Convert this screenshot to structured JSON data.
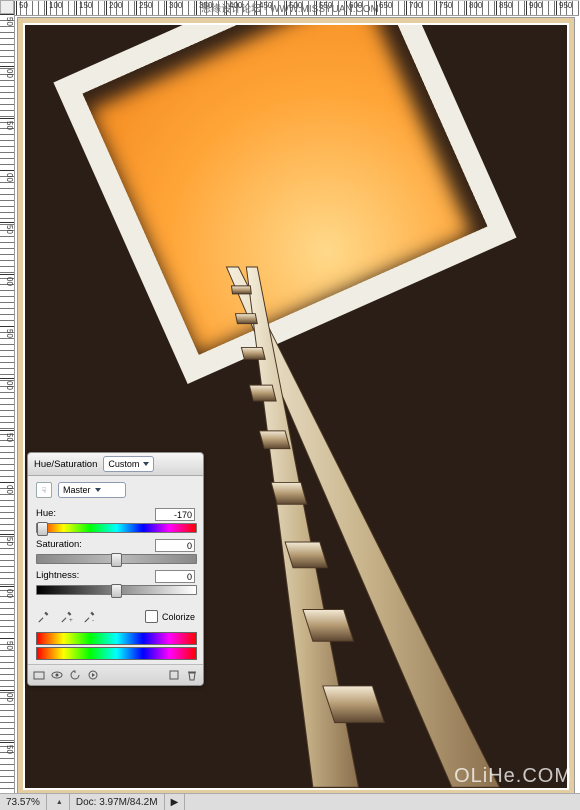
{
  "header_text": "思缘设计论坛 - WWW.MISSYUAN.COM",
  "watermark": "OLiHe.COM",
  "ruler_top": [
    "50",
    "100",
    "150",
    "200",
    "250",
    "300",
    "350",
    "400",
    "450",
    "500",
    "550",
    "600",
    "650",
    "700",
    "750",
    "800",
    "850",
    "900",
    "950"
  ],
  "ruler_left": [
    "50",
    "00",
    "50",
    "00",
    "50",
    "00",
    "50",
    "00",
    "50",
    "00",
    "50",
    "00",
    "50",
    "00",
    "50"
  ],
  "status": {
    "zoom": "73.57%",
    "doc": "Doc: 3.97M/84.2M"
  },
  "panel": {
    "title": "Hue/Saturation",
    "preset": "Custom",
    "channel": "Master",
    "hue_label": "Hue:",
    "hue_value": "-170",
    "sat_label": "Saturation:",
    "sat_value": "0",
    "light_label": "Lightness:",
    "light_value": "0",
    "colorize": "Colorize"
  }
}
